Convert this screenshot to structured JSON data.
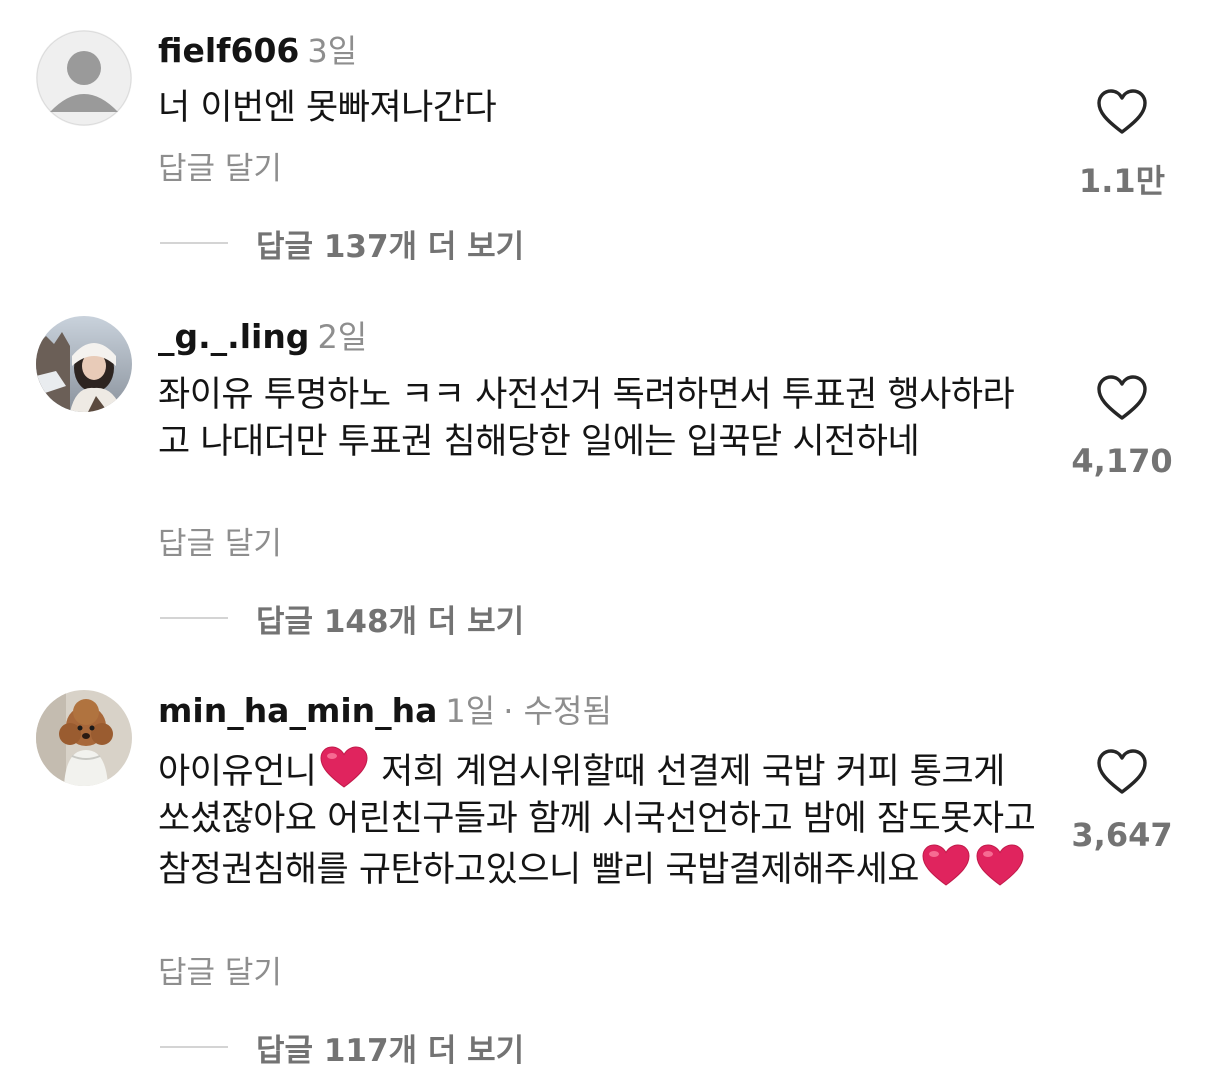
{
  "comments": [
    {
      "username": "fielf606",
      "time": "3일",
      "edited": "",
      "text": "너 이번엔 못빠져나간다",
      "reply_label": "답글 달기",
      "more_replies": "답글 137개 더 보기",
      "likes": "1.1만",
      "avatar": "default-avatar-icon"
    },
    {
      "username": "_g._.ling",
      "time": "2일",
      "edited": "",
      "text": "좌이유 투명하노 ㅋㅋ 사전선거 독려하면서 투표권 행사하라고 나대더만 투표권 침해당한 일에는 입꾹닫 시전하네",
      "reply_label": "답글 달기",
      "more_replies": "답글 148개 더 보기",
      "likes": "4,170",
      "avatar": "photo-avatar"
    },
    {
      "username": "min_ha_min_ha",
      "time": "1일",
      "edited": "· 수정됨",
      "text_parts": [
        "아이유언니",
        " 저희 계엄시위할때 선결제 국밥 커피 통크게 쏘셨잖아요 어린친구들과 함께 시국선언하고 밤에 잠도못자고 참정권침해를 규탄하고있으니 빨리 국밥결제해주세요"
      ],
      "reply_label": "답글 달기",
      "more_replies": "답글 117개 더 보기",
      "likes": "3,647",
      "avatar": "dog-photo-avatar"
    }
  ],
  "colors": {
    "text": "#141414",
    "muted": "#8e8e8e",
    "count": "#737373",
    "heart_emoji": "#e0245e"
  }
}
